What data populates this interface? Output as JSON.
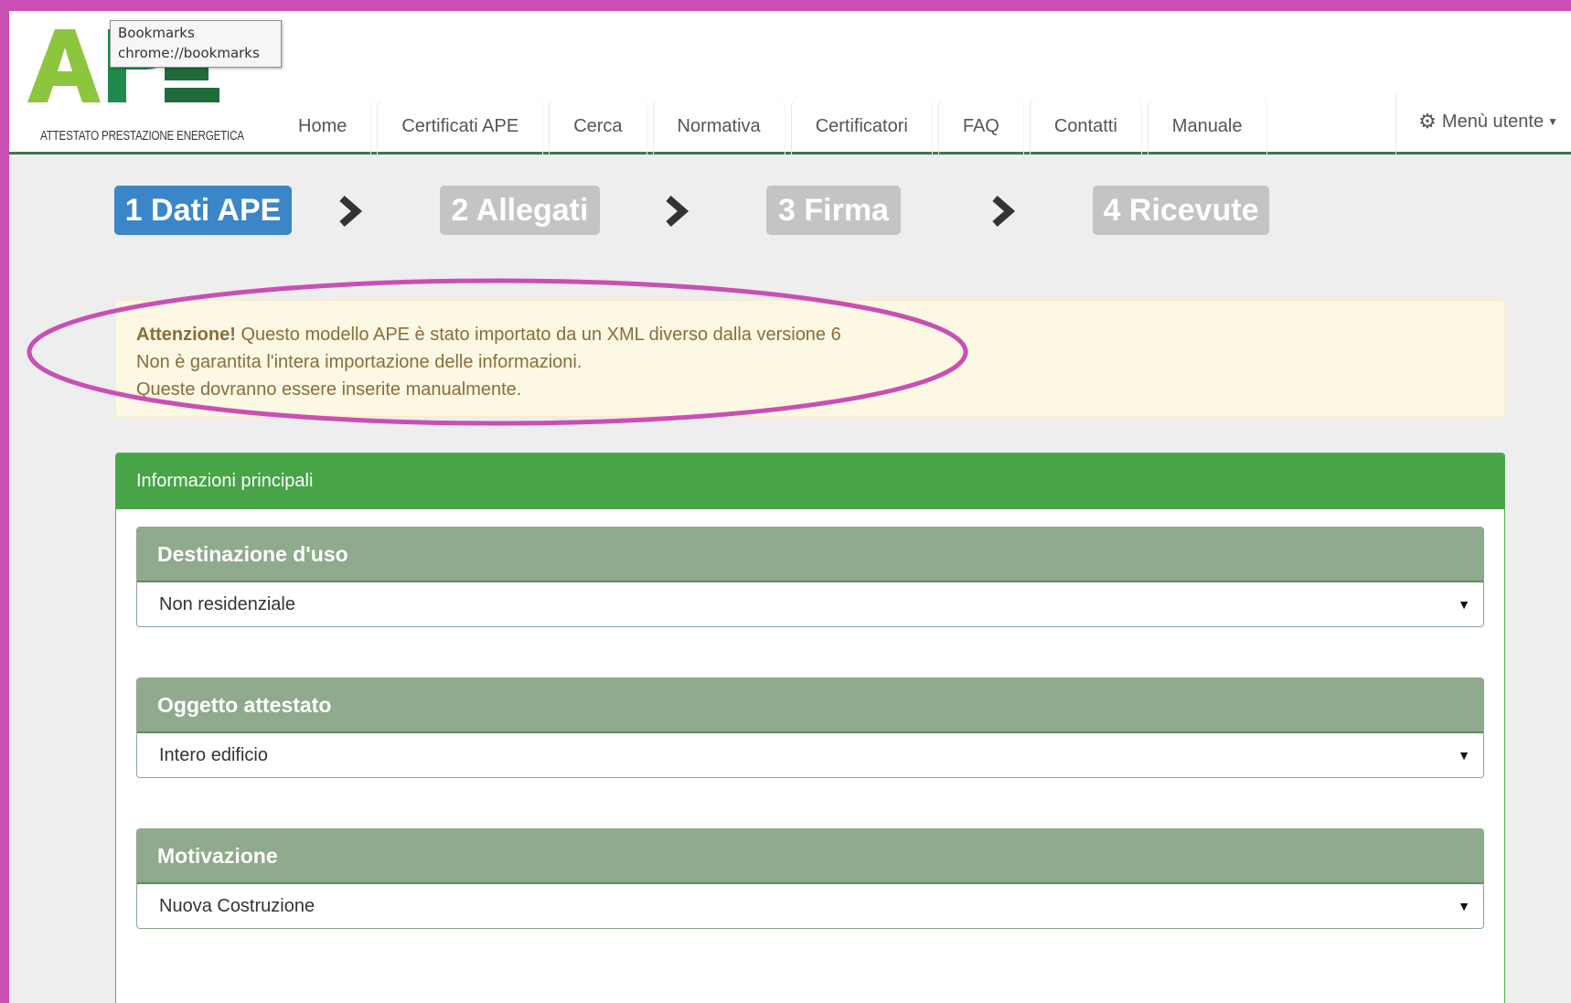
{
  "tooltip": {
    "line1": "Bookmarks",
    "line2": "chrome://bookmarks"
  },
  "logo": {
    "text": "APE",
    "subtitle": "ATTESTATO PRESTAZIONE ENERGETICA"
  },
  "nav": {
    "items": [
      "Home",
      "Certificati APE",
      "Cerca",
      "Normativa",
      "Certificatori",
      "FAQ",
      "Contatti",
      "Manuale"
    ],
    "user_menu": "Menù utente"
  },
  "steps": [
    {
      "label": "1 Dati APE",
      "state": "active"
    },
    {
      "label": "2 Allegati",
      "state": "inactive"
    },
    {
      "label": "3 Firma",
      "state": "inactive"
    },
    {
      "label": "4 Ricevute",
      "state": "inactive"
    }
  ],
  "alert": {
    "strong": "Attenzione!",
    "line1": " Questo modello APE è stato importato da un XML diverso dalla versione 6",
    "line2": "Non è garantita l'intera importazione delle informazioni.",
    "line3": "Queste dovranno essere inserite manualmente."
  },
  "panel": {
    "title": "Informazioni principali",
    "fields": [
      {
        "label": "Destinazione d'uso",
        "value": "Non residenziale"
      },
      {
        "label": "Oggetto attestato",
        "value": "Intero edificio"
      },
      {
        "label": "Motivazione",
        "value": "Nuova Costruzione"
      }
    ]
  },
  "colors": {
    "frame": "#c94fb4",
    "primary_step": "#3b86c8",
    "inactive_step": "#c4c4c4",
    "panel_header": "#47a447",
    "field_header": "#8faa8c",
    "alert_bg": "#fcf8e3",
    "alert_text": "#8a6d3b"
  }
}
